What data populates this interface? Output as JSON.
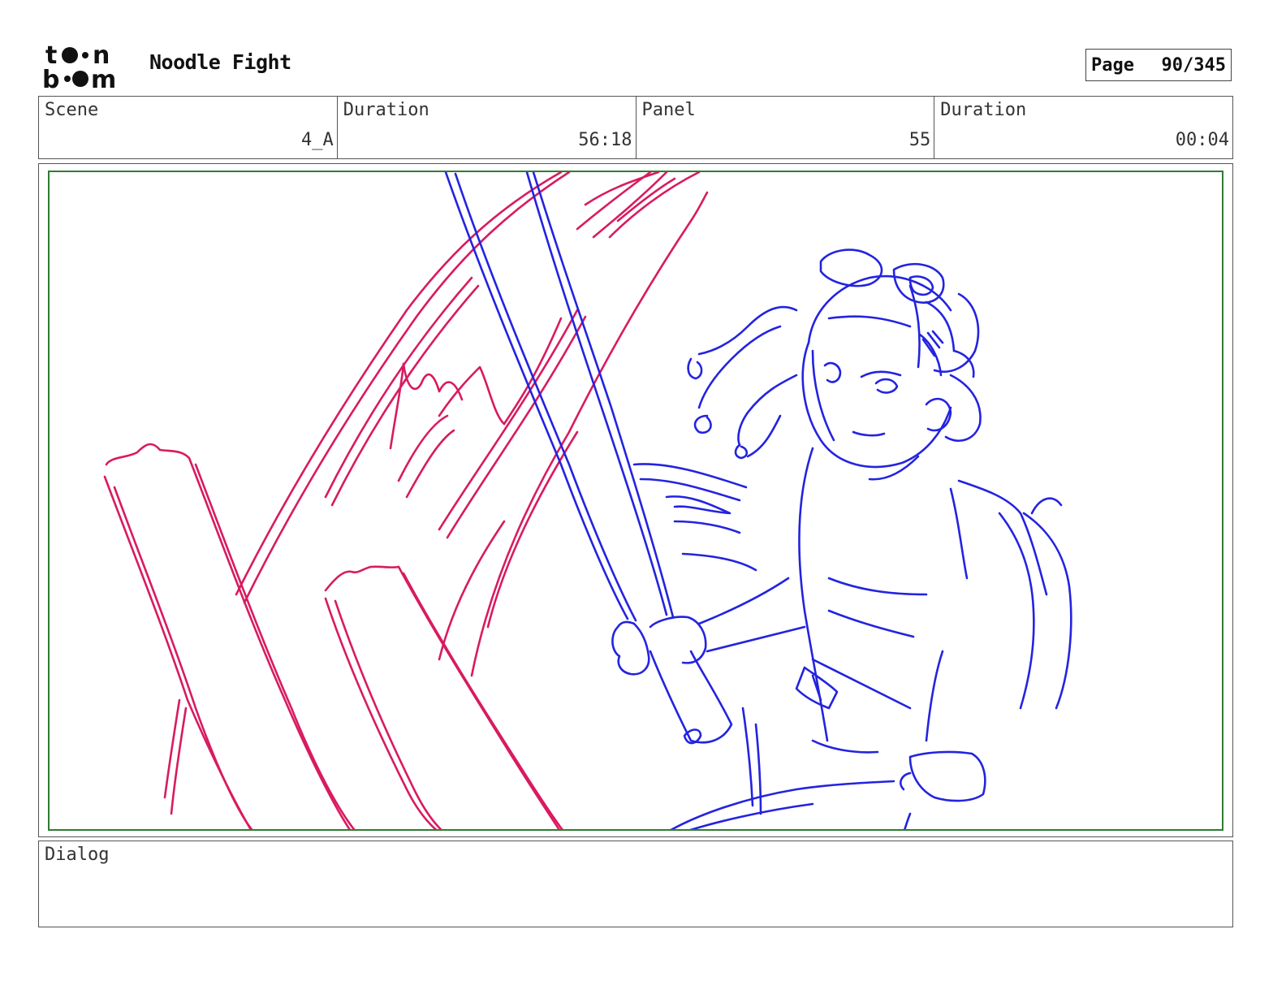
{
  "header": {
    "logo_text_top": "toon",
    "logo_text_bottom": "boom",
    "project_title": "Noodle Fight",
    "page_label": "Page",
    "page_value": "90/345"
  },
  "info": {
    "scene_label": "Scene",
    "scene_value": "4_A",
    "scene_duration_label": "Duration",
    "scene_duration_value": "56:18",
    "panel_label": "Panel",
    "panel_value": "55",
    "panel_duration_label": "Duration",
    "panel_duration_value": "00:04"
  },
  "panel": {
    "frame_color": "#2e7d32",
    "sketch_colors": {
      "background_layer": "#d81b60",
      "character_layer": "#2323e0"
    }
  },
  "dialog": {
    "label": "Dialog",
    "text": ""
  }
}
